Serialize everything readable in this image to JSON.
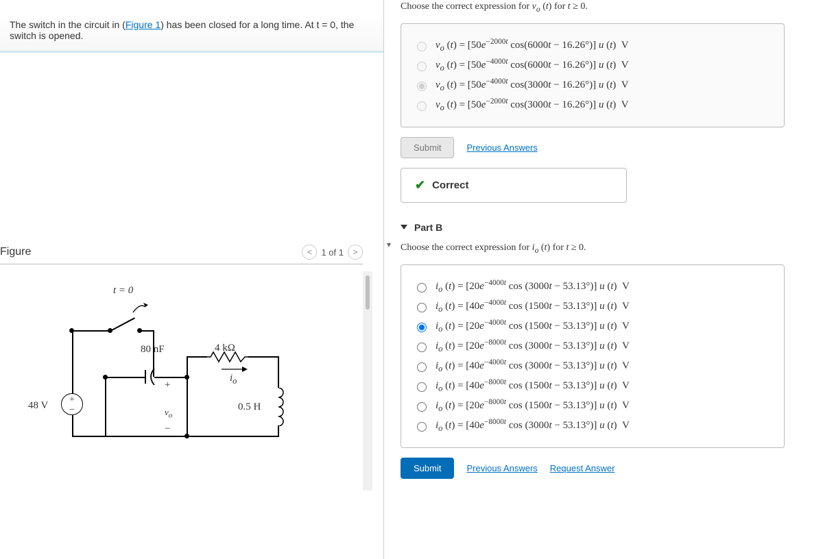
{
  "left": {
    "prompt_pre": "The switch in the circuit in (",
    "prompt_link": "Figure 1",
    "prompt_post": ") has been closed for a long time. At t = 0, the switch is opened.",
    "figure_title": "Figure",
    "pager_text": "1 of 1",
    "circuit": {
      "t0": "t = 0",
      "cap": "80 nF",
      "vo": "v",
      "vo_sub": "o",
      "res": "4 kΩ",
      "io": "i",
      "io_sub": "o",
      "ind": "0.5 H",
      "src": "48 V",
      "plus": "+",
      "minus": "−"
    }
  },
  "partA": {
    "prompt": "Choose the correct expression for vₒ (t) for t ≥ 0.",
    "opts": [
      "vₒ (t) = [50e⁻²⁰⁰⁰ᵗ cos(6000t − 16.26°)] u (t)  V",
      "vₒ (t) = [50e⁻⁴⁰⁰⁰ᵗ cos(6000t − 16.26°)] u (t)  V",
      "vₒ (t) = [50e⁻⁴⁰⁰⁰ᵗ cos(3000t − 16.26°)] u (t)  V",
      "vₒ (t) = [50e⁻²⁰⁰⁰ᵗ cos(3000t − 16.26°)] u (t)  V"
    ],
    "submit": "Submit",
    "prev": "Previous Answers",
    "correct": "Correct"
  },
  "partB": {
    "title": "Part B",
    "prompt": "Choose the correct expression for iₒ (t) for t ≥ 0.",
    "opts": [
      "iₒ (t) = [20e⁻⁴⁰⁰⁰ᵗ cos (3000t − 53.13°)] u (t)  V",
      "iₒ (t) = [40e⁻⁴⁰⁰⁰ᵗ cos (1500t − 53.13°)] u (t)  V",
      "iₒ (t) = [20e⁻⁴⁰⁰⁰ᵗ cos (1500t − 53.13°)] u (t)  V",
      "iₒ (t) = [20e⁻⁸⁰⁰⁰ᵗ cos (3000t − 53.13°)] u (t)  V",
      "iₒ (t) = [40e⁻⁴⁰⁰⁰ᵗ cos (3000t − 53.13°)] u (t)  V",
      "iₒ (t) = [40e⁻⁸⁰⁰⁰ᵗ cos (1500t − 53.13°)] u (t)  V",
      "iₒ (t) = [20e⁻⁸⁰⁰⁰ᵗ cos (1500t − 53.13°)] u (t)  V",
      "iₒ (t) = [40e⁻⁸⁰⁰⁰ᵗ cos (3000t − 53.13°)] u (t)  V"
    ],
    "submit": "Submit",
    "prev": "Previous Answers",
    "req": "Request Answer"
  }
}
